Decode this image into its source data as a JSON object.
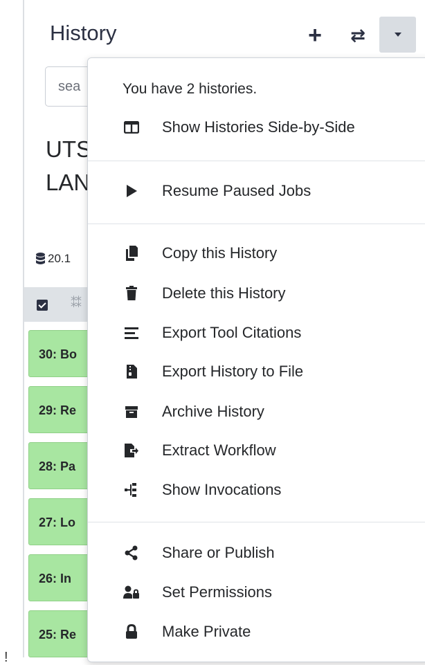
{
  "header": {
    "title": "History",
    "new_icon": "plus-icon",
    "switch_icon": "exchange-icon",
    "options_icon": "caret-down-icon"
  },
  "search": {
    "value": "sea"
  },
  "history": {
    "name_line1": "UTS",
    "name_line2": "LAN",
    "size": "20.1"
  },
  "datasets": [
    "30: Bo",
    "29: Re",
    "28: Pa",
    "27: Lo",
    "26: In",
    "25: Re"
  ],
  "menu": {
    "info": "You have 2 histories.",
    "items": [
      {
        "label": "Show Histories Side-by-Side",
        "icon": "columns-icon"
      },
      {
        "label": "Resume Paused Jobs",
        "icon": "play-icon"
      },
      {
        "label": "Copy this History",
        "icon": "copy-icon"
      },
      {
        "label": "Delete this History",
        "icon": "trash-icon"
      },
      {
        "label": "Export Tool Citations",
        "icon": "list-icon"
      },
      {
        "label": "Export History to File",
        "icon": "file-archive-icon"
      },
      {
        "label": "Archive History",
        "icon": "archive-icon"
      },
      {
        "label": "Extract Workflow",
        "icon": "file-export-icon"
      },
      {
        "label": "Show Invocations",
        "icon": "sitemap-icon"
      },
      {
        "label": "Share or Publish",
        "icon": "share-icon"
      },
      {
        "label": "Set Permissions",
        "icon": "user-lock-icon"
      },
      {
        "label": "Make Private",
        "icon": "lock-icon"
      }
    ]
  },
  "colors": {
    "dataset_ok": "#a8e6a1",
    "dark": "#2c3143"
  }
}
